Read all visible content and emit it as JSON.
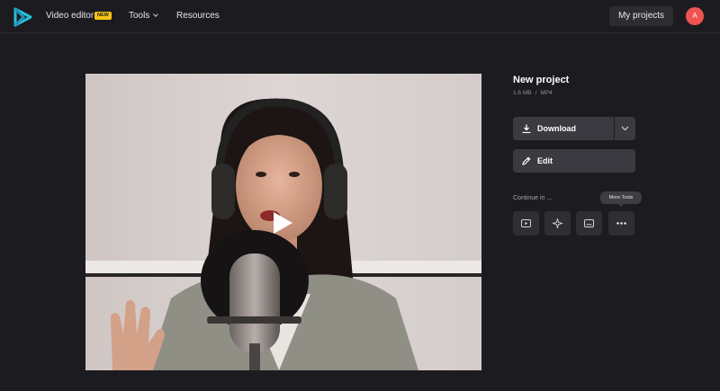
{
  "header": {
    "logo_icon": "play-triangle-logo-icon",
    "video_editor_label": "Video editor",
    "new_badge": "NEW",
    "tools_label": "Tools",
    "resources_label": "Resources",
    "my_projects_label": "My projects",
    "avatar_initial": "A"
  },
  "project": {
    "title": "New project",
    "size": "1.6 MB",
    "separator": "/",
    "format": "MP4"
  },
  "actions": {
    "download_label": "Download",
    "edit_label": "Edit",
    "continue_label": "Continue in ...",
    "tools": [
      "video-player-icon",
      "sparkle-icon",
      "subtitles-icon",
      "more-dots-icon"
    ],
    "tooltip": "More Tools"
  },
  "colors": {
    "accent": "#27c0d8",
    "badge": "#f5c518",
    "avatar": "#ef5350",
    "background": "#1c1c20"
  }
}
